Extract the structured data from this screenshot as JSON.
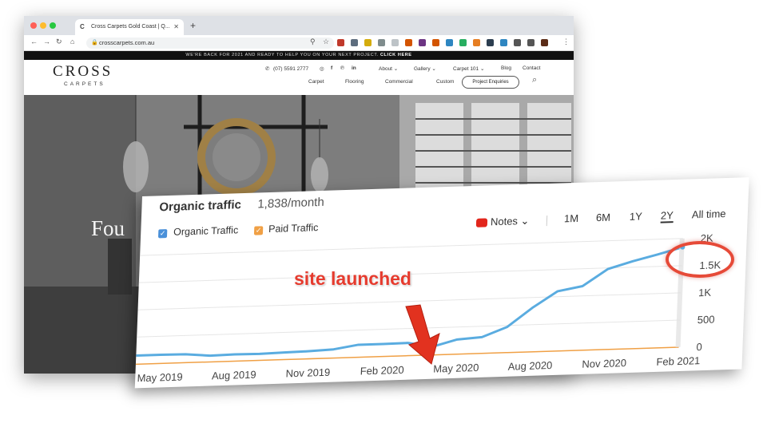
{
  "browser": {
    "tab_title": "Cross Carpets Gold Coast | Q...",
    "tab_icon": "C",
    "new_tab": "+",
    "url": "crosscarpets.com.au",
    "traffic_lights": [
      "#ff5f57",
      "#febc2e",
      "#28c840"
    ],
    "extension_colors": [
      "#c0392b",
      "#5d6d7e",
      "#d4ac0d",
      "#7f8c8d",
      "#bdc3c7",
      "#d35400",
      "#6c3483",
      "#d35400",
      "#2e86c1",
      "#27ae60",
      "#e67e22",
      "#2c3e50",
      "#2e86c1",
      "#555555",
      "#555555",
      "#5b2c17"
    ]
  },
  "site": {
    "banner_text": "WE'RE BACK FOR 2021 AND READY TO HELP YOU ON YOUR NEXT PROJECT.",
    "banner_link": "CLICK HERE",
    "logo_main": "CROSS",
    "logo_sub": "CARPETS",
    "phone": "(07) 5591 2777",
    "social": [
      "◎",
      "f",
      "℗",
      "in"
    ],
    "nav_top": [
      "About ⌄",
      "Gallery ⌄",
      "Carpet 101 ⌄",
      "Blog",
      "Contact"
    ],
    "nav_bottom": [
      "Carpet",
      "Flooring",
      "Commercial",
      "Custom"
    ],
    "enquiry_button": "Project Enquiries",
    "hero_text": "Fou"
  },
  "panel": {
    "title": "Organic traffic",
    "subtitle": "1,838/month",
    "legend": [
      "Organic Traffic",
      "Paid Traffic"
    ],
    "notes_label": "Notes ⌄",
    "ranges": [
      "1M",
      "6M",
      "1Y",
      "2Y",
      "All time"
    ],
    "active_range": "2Y",
    "colors": {
      "organic": "#5aace0",
      "paid": "#f0a045",
      "accent": "#e2261c"
    }
  },
  "annotation": {
    "label": "site launched",
    "circle_color": "#e64a38"
  },
  "chart_data": {
    "type": "line",
    "x": [
      "Apr 2019",
      "May 2019",
      "Jun 2019",
      "Jul 2019",
      "Aug 2019",
      "Sep 2019",
      "Oct 2019",
      "Nov 2019",
      "Dec 2019",
      "Jan 2020",
      "Feb 2020",
      "Mar 2020",
      "Apr 2020",
      "May 2020",
      "Jun 2020",
      "Jul 2020",
      "Aug 2020",
      "Sep 2020",
      "Oct 2020",
      "Nov 2020",
      "Dec 2020",
      "Jan 2021",
      "Feb 2021"
    ],
    "x_tick_labels": [
      "May 2019",
      "Aug 2019",
      "Nov 2019",
      "Feb 2020",
      "May 2020",
      "Aug 2020",
      "Nov 2020",
      "Feb 2021"
    ],
    "y_tick_labels": [
      "2K",
      "1.5K",
      "1K",
      "500",
      "0"
    ],
    "ylim": [
      0,
      2000
    ],
    "series": [
      {
        "name": "Organic Traffic",
        "values": [
          160,
          160,
          155,
          115,
          125,
          120,
          130,
          140,
          160,
          230,
          230,
          235,
          150,
          270,
          300,
          470,
          810,
          1100,
          1180,
          1480,
          1610,
          1720,
          1840
        ]
      },
      {
        "name": "Paid Traffic",
        "values": [
          0,
          0,
          0,
          0,
          0,
          0,
          0,
          0,
          0,
          0,
          0,
          0,
          0,
          0,
          0,
          0,
          0,
          0,
          0,
          0,
          0,
          0,
          0
        ]
      }
    ],
    "legend_position": "top-left",
    "grid": true
  }
}
